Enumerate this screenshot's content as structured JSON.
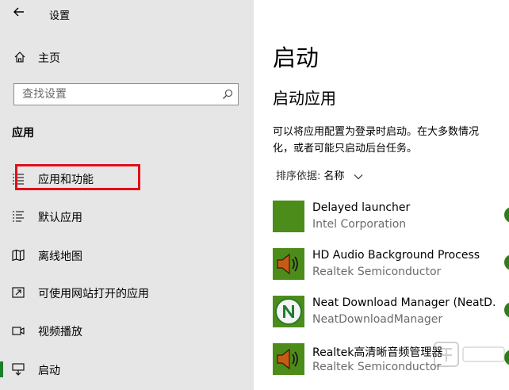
{
  "window": {
    "title": "设置"
  },
  "sidebar": {
    "home_label": "主页",
    "search_placeholder": "查找设置",
    "section_title": "应用",
    "items": [
      {
        "label": "应用和功能",
        "icon": "apps-features-icon"
      },
      {
        "label": "默认应用",
        "icon": "default-apps-icon"
      },
      {
        "label": "离线地图",
        "icon": "offline-maps-icon"
      },
      {
        "label": "可使用网站打开的应用",
        "icon": "apps-for-websites-icon"
      },
      {
        "label": "视频播放",
        "icon": "video-playback-icon"
      },
      {
        "label": "启动",
        "icon": "startup-icon",
        "selected": true
      }
    ]
  },
  "main": {
    "title": "启动",
    "subtitle": "启动应用",
    "description_line1": "可以将应用配置为登录时启动。在大多数情况",
    "description_line2": "化，或者可能只启动后台任务。",
    "sort_label": "排序依据:",
    "sort_value": "名称",
    "apps": [
      {
        "name": "Delayed launcher",
        "publisher": "Intel Corporation",
        "icon": "intel-green-tile-icon",
        "enabled": true
      },
      {
        "name": "HD Audio Background Process",
        "publisher": "Realtek Semiconductor",
        "icon": "speaker-icon",
        "enabled": true
      },
      {
        "name": "Neat Download Manager (NeatD…",
        "publisher": "NeatDownloadManager",
        "icon": "neat-download-manager-icon",
        "enabled": true
      },
      {
        "name": "Realtek高清晰音频管理器",
        "publisher": "Realtek Semiconductor",
        "icon": "speaker-icon",
        "enabled": true
      }
    ]
  },
  "colors": {
    "accent": "#1e7d2e",
    "highlight_box": "#e0101a",
    "sidebar_bg": "#e6e6e6",
    "toggle_on": "#2e7d18",
    "intel_tile": "#4c8c1a"
  }
}
